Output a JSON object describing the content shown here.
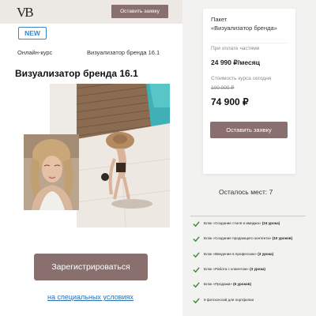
{
  "header": {
    "logo_text": "VB",
    "cta_label": "Оставить заявку"
  },
  "badge": "NEW",
  "course": {
    "type_label": "Онлайн-курс",
    "name_label": "Визуализатор бренда 16.1",
    "title": "Визуализатор бренда 16.1"
  },
  "actions": {
    "register_label": "Зарегистрироваться",
    "special_link": "на специальных условиях"
  },
  "package_card": {
    "label": "Пакет",
    "name": "«Визуализатор бренда»",
    "installment_label": "При оплате частями",
    "installment_price": "24 990 ₽/месяц",
    "today_label": "Стоимость курса сегодня",
    "old_price": "100 000 ₽",
    "new_price": "74 900 ₽",
    "button_label": "Оставить заявку"
  },
  "seats_left": "Осталось мест: 7",
  "features": [
    {
      "text": "Блок «Создание стиля и имиджа»",
      "count": "(24 урока)"
    },
    {
      "text": "Блок «Создание продающего контента»",
      "count": "(10 уроков)"
    },
    {
      "text": "Блок «Введение в профессию»",
      "count": "(3 урока)"
    },
    {
      "text": "Блок «Работа с клиентом»",
      "count": "(3 урока)"
    },
    {
      "text": "Блок «Продажи»",
      "count": "(6 уроков)"
    },
    {
      "text": "9 фотосессий для портфолио",
      "count": ""
    }
  ],
  "colors": {
    "accent": "#8a6f6f",
    "link": "#2a6fb0",
    "badge": "#3a86c8",
    "check": "#3a8a3a"
  }
}
